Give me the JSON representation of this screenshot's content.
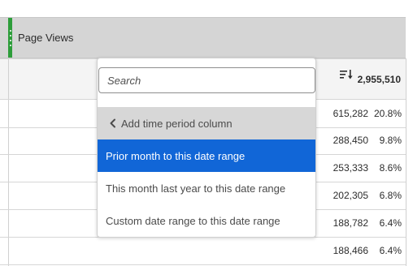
{
  "column": {
    "title": "Page Views",
    "accent_color": "#2d9d3a"
  },
  "totals": {
    "sort_icon": "sort-descending-icon",
    "value": "2,955,510"
  },
  "rows": [
    {
      "value": "615,282",
      "percent": "20.8%"
    },
    {
      "value": "288,450",
      "percent": "9.8%"
    },
    {
      "value": "253,333",
      "percent": "8.6%"
    },
    {
      "value": "202,305",
      "percent": "6.8%"
    },
    {
      "value": "188,782",
      "percent": "6.4%"
    },
    {
      "value": "188,466",
      "percent": "6.4%"
    }
  ],
  "dropdown": {
    "search_placeholder": "Search",
    "back_label": "Add time period column",
    "items": [
      {
        "label": "Prior month to this date range",
        "selected": true
      },
      {
        "label": "This month last year to this date range",
        "selected": false
      },
      {
        "label": "Custom date range to this date range",
        "selected": false
      }
    ],
    "selected_color": "#1166d7"
  }
}
